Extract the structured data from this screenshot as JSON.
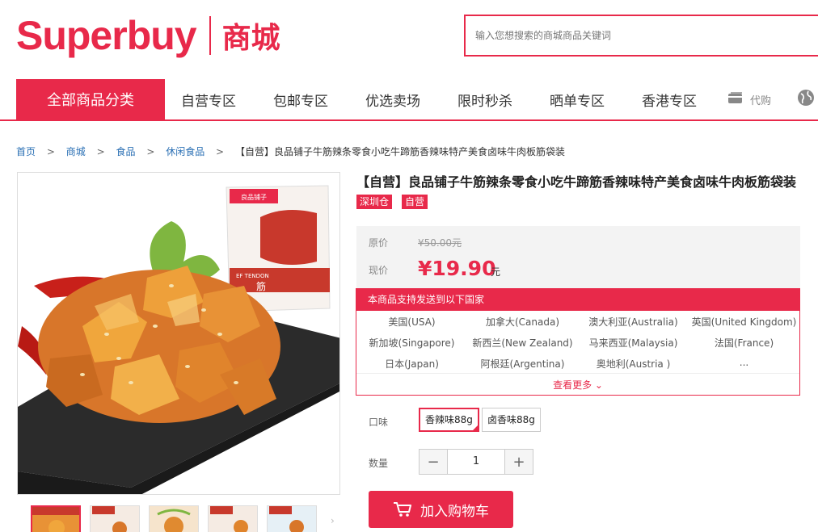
{
  "header": {
    "logo_text": "Superbuy",
    "logo_sub": "商城",
    "search_placeholder": "输入您想搜索的商城商品关键词"
  },
  "nav": {
    "all_categories": "全部商品分类",
    "items": [
      "自营专区",
      "包邮专区",
      "优选卖场",
      "限时秒杀",
      "晒单专区",
      "香港专区"
    ],
    "daigou": "代购"
  },
  "breadcrumb": {
    "home": "首页",
    "mall": "商城",
    "food": "食品",
    "snacks": "休闲食品",
    "current": "【自营】良品铺子牛筋辣条零食小吃牛蹄筋香辣味特产美食卤味牛肉板筋袋装"
  },
  "product": {
    "title": "【自营】良品铺子牛筋辣条零食小吃牛蹄筋香辣味特产美食卤味牛肉板筋袋装",
    "tags": [
      "深圳仓",
      "自营"
    ],
    "package_brand": "良品铺子",
    "package_sub": "EF TENDON",
    "package_name": "筋",
    "original_price_label": "原价",
    "original_price": "¥50.00元",
    "current_price_label": "现价",
    "current_price": "¥19.90",
    "current_price_unit": "元"
  },
  "shipping": {
    "heading": "本商品支持发送到以下国家",
    "countries": [
      "美国(USA)",
      "加拿大(Canada)",
      "澳大利亚(Australia)",
      "英国(United Kingdom)",
      "新加坡(Singapore)",
      "新西兰(New Zealand)",
      "马来西亚(Malaysia)",
      "法国(France)",
      "日本(Japan)",
      "阿根廷(Argentina)",
      "奥地利(Austria )",
      "..."
    ],
    "more": "查看更多 ⌄"
  },
  "options": {
    "flavor_label": "口味",
    "flavors": [
      "香辣味88g",
      "卤香味88g"
    ],
    "selected_flavor": "香辣味88g",
    "quantity_label": "数量",
    "quantity": "1",
    "add_to_cart": "加入购物车"
  },
  "colors": {
    "accent": "#e8294a",
    "link": "#2a6fb4"
  }
}
